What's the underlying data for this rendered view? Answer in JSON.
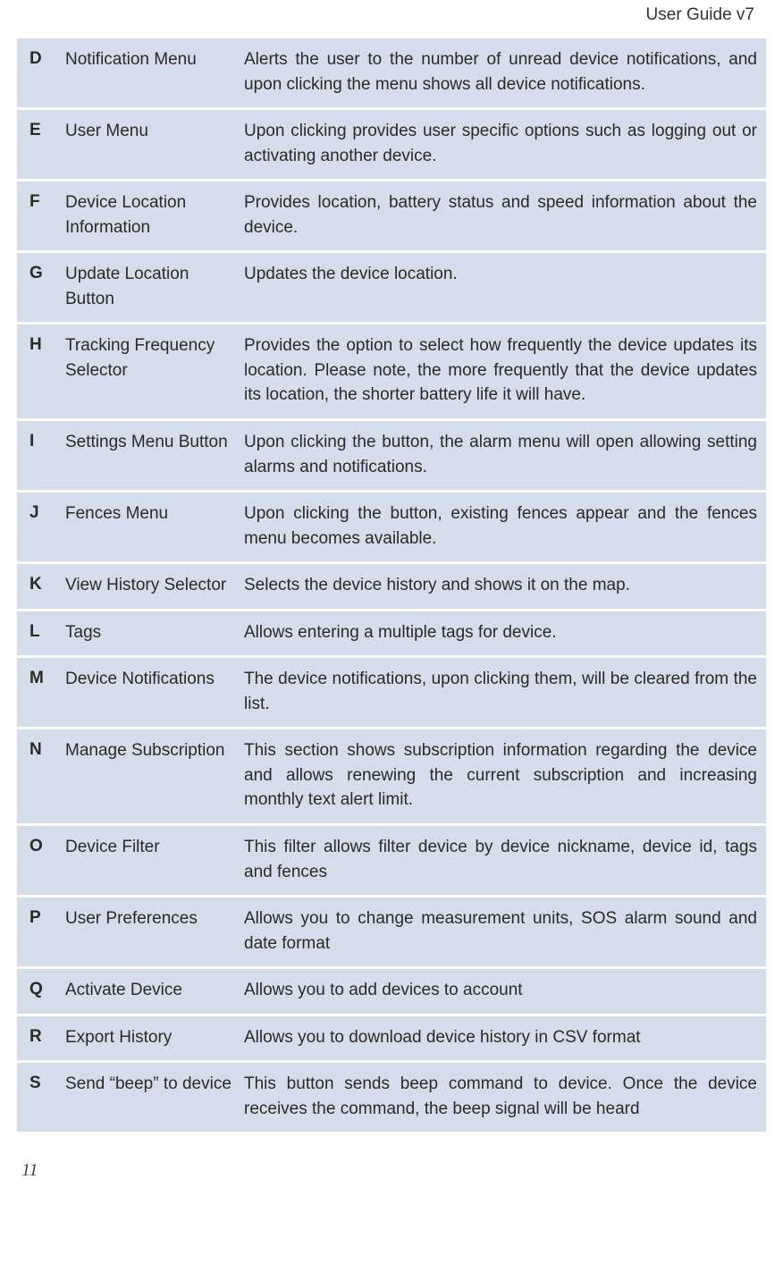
{
  "header": {
    "title": "User Guide v7"
  },
  "rows": [
    {
      "letter": "D",
      "name": " Notification Menu",
      "desc": "Alerts the user to the number of unread device notifications, and upon clicking the menu shows all device notifications."
    },
    {
      "letter": "E",
      "name": " User Menu",
      "desc": "Upon clicking provides user specific options such as logging out or activating another device."
    },
    {
      "letter": "F",
      "name": "Device Location Information",
      "desc": "Provides location, battery status and speed information about the device."
    },
    {
      "letter": "G",
      "name": "Update Location Button",
      "desc": "Updates the device location."
    },
    {
      "letter": "H",
      "name": "Tracking Frequency Selector",
      "desc": "Provides the option to select how frequently the device updates its location. Please note, the more frequently that the device updates its location, the shorter battery life it will have."
    },
    {
      "letter": "I",
      "name": "Settings Menu Button",
      "desc": "Upon clicking the button, the alarm menu will open allowing setting alarms and notifications."
    },
    {
      "letter": "J",
      "name": "Fences Menu",
      "desc": "Upon clicking the button, existing fences appear and the fences menu becomes available."
    },
    {
      "letter": "K",
      "name": "View History Selector",
      "desc": "Selects the device history and shows it on the map."
    },
    {
      "letter": "L",
      "name": "Tags",
      "desc": "Allows entering a multiple tags for device."
    },
    {
      "letter": "M",
      "name": "Device Notifications",
      "desc": "The device notifications, upon clicking them, will be cleared from the list."
    },
    {
      "letter": "N",
      "name": "Manage Subscription",
      "desc": "This section shows subscription information regarding the device and allows renewing the current subscription and increasing monthly text alert limit."
    },
    {
      "letter": "O",
      "name": "Device Filter",
      "desc": "This filter allows filter device by device nickname, device id, tags and fences"
    },
    {
      "letter": "P",
      "name": "User Preferences",
      "desc": "Allows you to change measurement units, SOS alarm sound and date format"
    },
    {
      "letter": "Q",
      "name": "Activate Device",
      "desc": "Allows you to add devices to account"
    },
    {
      "letter": "R",
      "name": "Export History",
      "desc": "Allows you to download device history in CSV format"
    },
    {
      "letter": "S",
      "name": "Send “beep” to device",
      "desc": "This button sends beep command to device. Once the device receives the command, the beep signal will be heard"
    }
  ],
  "footer": {
    "page_number": "11"
  }
}
